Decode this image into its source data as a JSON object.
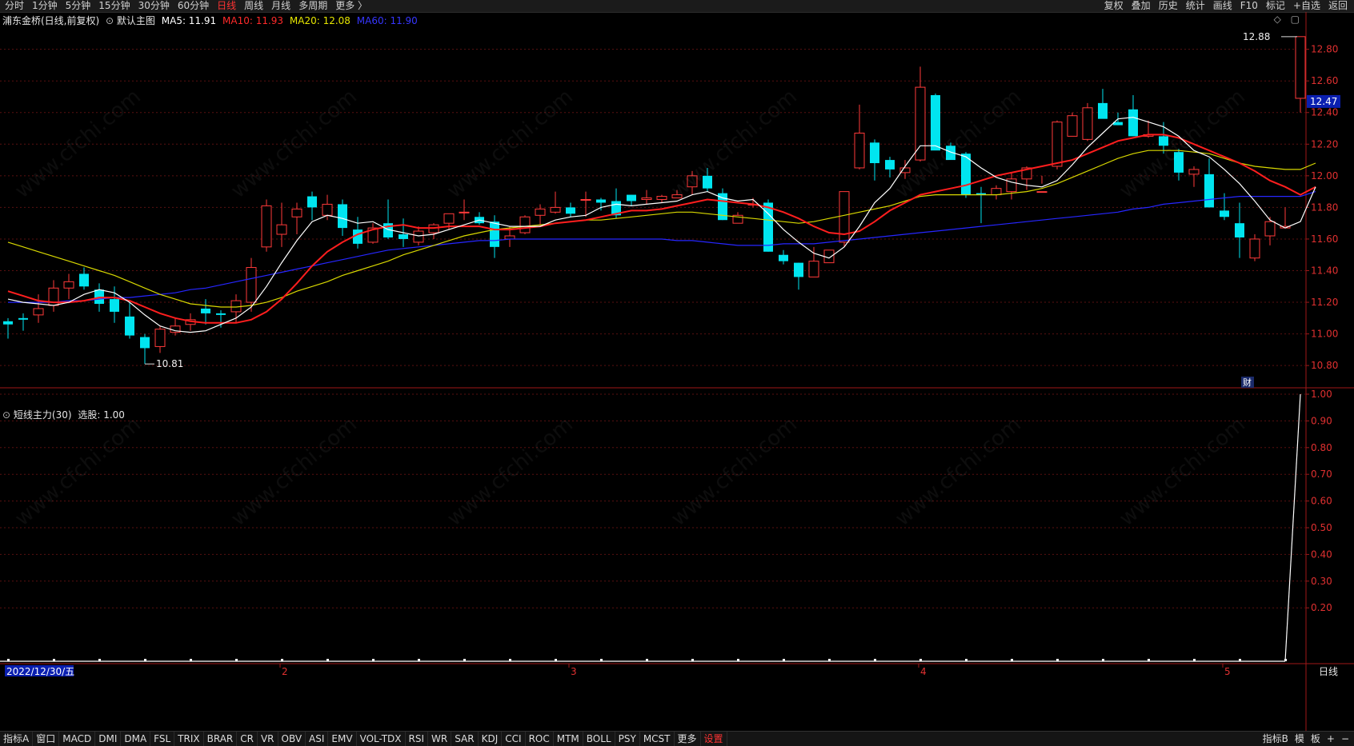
{
  "topbar": {
    "periods": [
      "分时",
      "1分钟",
      "5分钟",
      "15分钟",
      "30分钟",
      "60分钟",
      "日线",
      "周线",
      "月线",
      "多周期",
      "更多 〉"
    ],
    "active_period": "日线",
    "right_items": [
      "复权",
      "叠加",
      "历史",
      "统计",
      "画线",
      "F10",
      "标记",
      "+自选",
      "返回"
    ]
  },
  "main_panel": {
    "title": "浦东金桥(日线,前复权)",
    "template": "默认主图",
    "ma5": {
      "label": "MA5: 11.91",
      "color": "#ffffff"
    },
    "ma10": {
      "label": "MA10: 11.93",
      "color": "#ff2a2a"
    },
    "ma20": {
      "label": "MA20: 12.08",
      "color": "#e6e600"
    },
    "ma60": {
      "label": "MA60: 11.90",
      "color": "#2f2fff"
    },
    "y_ticks": [
      "12.80",
      "12.60",
      "12.40",
      "12.20",
      "12.00",
      "11.80",
      "11.60",
      "11.40",
      "11.20",
      "11.00",
      "10.80"
    ],
    "current_price": "12.47",
    "high_label": "12.88",
    "low_label": "10.81",
    "cai_label": "财"
  },
  "sub_panel": {
    "title": "短线主力(30)",
    "value_label": "选股: 1.00",
    "y_ticks": [
      "1.00",
      "0.90",
      "0.80",
      "0.70",
      "0.60",
      "0.50",
      "0.40",
      "0.30",
      "0.20"
    ]
  },
  "x_axis": {
    "date_label": "2022/12/30/五",
    "month_labels": [
      "2",
      "3",
      "4",
      "5"
    ],
    "period_label": "日线"
  },
  "bottombar": {
    "tabs": [
      "指标A",
      "窗口",
      "MACD",
      "DMI",
      "DMA",
      "FSL",
      "TRIX",
      "BRAR",
      "CR",
      "VR",
      "OBV",
      "ASI",
      "EMV",
      "VOL-TDX",
      "RSI",
      "WR",
      "SAR",
      "KDJ",
      "CCI",
      "ROC",
      "MTM",
      "BOLL",
      "PSY",
      "MCST",
      "更多",
      "设置"
    ],
    "active_tab": "设置",
    "right": [
      "指标B",
      "模",
      "板",
      "+",
      "−"
    ]
  },
  "chart_data": {
    "type": "candlestick",
    "ohlc": [
      [
        11.08,
        11.1,
        10.97,
        11.06
      ],
      [
        11.1,
        11.13,
        11.02,
        11.09
      ],
      [
        11.12,
        11.25,
        11.07,
        11.16
      ],
      [
        11.18,
        11.34,
        11.14,
        11.29
      ],
      [
        11.29,
        11.38,
        11.22,
        11.33
      ],
      [
        11.38,
        11.42,
        11.28,
        11.3
      ],
      [
        11.28,
        11.32,
        11.14,
        11.19
      ],
      [
        11.22,
        11.3,
        11.07,
        11.14
      ],
      [
        11.11,
        11.2,
        10.97,
        10.99
      ],
      [
        10.98,
        11.0,
        10.81,
        10.91
      ],
      [
        10.92,
        11.05,
        10.88,
        11.03
      ],
      [
        11.01,
        11.1,
        10.99,
        11.05
      ],
      [
        11.06,
        11.13,
        11.02,
        11.09
      ],
      [
        11.16,
        11.22,
        11.06,
        11.13
      ],
      [
        11.13,
        11.15,
        11.04,
        11.12
      ],
      [
        11.14,
        11.25,
        11.07,
        11.21
      ],
      [
        11.2,
        11.48,
        11.14,
        11.42
      ],
      [
        11.55,
        11.85,
        11.52,
        11.81
      ],
      [
        11.63,
        11.83,
        11.55,
        11.69
      ],
      [
        11.74,
        11.83,
        11.63,
        11.79
      ],
      [
        11.87,
        11.9,
        11.72,
        11.8
      ],
      [
        11.75,
        11.88,
        11.72,
        11.82
      ],
      [
        11.82,
        11.85,
        11.62,
        11.67
      ],
      [
        11.66,
        11.74,
        11.54,
        11.57
      ],
      [
        11.58,
        11.7,
        11.57,
        11.67
      ],
      [
        11.7,
        11.85,
        11.6,
        11.61
      ],
      [
        11.63,
        11.73,
        11.55,
        11.6
      ],
      [
        11.58,
        11.68,
        11.56,
        11.65
      ],
      [
        11.64,
        11.7,
        11.6,
        11.69
      ],
      [
        11.7,
        11.75,
        11.66,
        11.76
      ],
      [
        11.77,
        11.85,
        11.72,
        11.77
      ],
      [
        11.74,
        11.77,
        11.69,
        11.7
      ],
      [
        11.71,
        11.75,
        11.48,
        11.55
      ],
      [
        11.6,
        11.68,
        11.55,
        11.62
      ],
      [
        11.64,
        11.75,
        11.63,
        11.74
      ],
      [
        11.75,
        11.82,
        11.68,
        11.79
      ],
      [
        11.77,
        11.9,
        11.76,
        11.8
      ],
      [
        11.8,
        11.83,
        11.74,
        11.76
      ],
      [
        11.85,
        11.9,
        11.74,
        11.85
      ],
      [
        11.85,
        11.86,
        11.78,
        11.83
      ],
      [
        11.84,
        11.92,
        11.73,
        11.75
      ],
      [
        11.88,
        11.88,
        11.81,
        11.84
      ],
      [
        11.85,
        11.91,
        11.82,
        11.86
      ],
      [
        11.85,
        11.88,
        11.83,
        11.87
      ],
      [
        11.86,
        11.91,
        11.86,
        11.88
      ],
      [
        11.93,
        12.03,
        11.88,
        12.0
      ],
      [
        12.0,
        12.05,
        11.9,
        11.92
      ],
      [
        11.89,
        11.92,
        11.72,
        11.72
      ],
      [
        11.7,
        11.77,
        11.7,
        11.75
      ],
      [
        11.82,
        11.86,
        11.8,
        11.82
      ],
      [
        11.83,
        11.85,
        11.52,
        11.52
      ],
      [
        11.5,
        11.53,
        11.44,
        11.46
      ],
      [
        11.45,
        11.45,
        11.28,
        11.36
      ],
      [
        11.36,
        11.55,
        11.36,
        11.46
      ],
      [
        11.45,
        11.53,
        11.48,
        11.53
      ],
      [
        11.58,
        11.9,
        11.55,
        11.9
      ],
      [
        12.05,
        12.45,
        12.04,
        12.27
      ],
      [
        12.21,
        12.23,
        11.97,
        12.08
      ],
      [
        12.1,
        12.12,
        11.99,
        12.04
      ],
      [
        12.02,
        12.1,
        11.98,
        12.05
      ],
      [
        12.1,
        12.69,
        12.09,
        12.56
      ],
      [
        12.51,
        12.52,
        12.21,
        12.16
      ],
      [
        12.19,
        12.21,
        12.12,
        12.1
      ],
      [
        12.14,
        12.15,
        11.86,
        11.88
      ],
      [
        11.89,
        11.93,
        11.7,
        11.88
      ],
      [
        11.88,
        11.94,
        11.85,
        11.92
      ],
      [
        11.9,
        12.02,
        11.85,
        11.98
      ],
      [
        11.98,
        12.06,
        11.91,
        12.05
      ],
      [
        11.9,
        12.0,
        11.95,
        11.9
      ],
      [
        12.06,
        12.35,
        12.04,
        12.34
      ],
      [
        12.25,
        12.4,
        12.28,
        12.38
      ],
      [
        12.23,
        12.46,
        12.22,
        12.43
      ],
      [
        12.46,
        12.55,
        12.42,
        12.36
      ],
      [
        12.34,
        12.4,
        12.32,
        12.32
      ],
      [
        12.42,
        12.51,
        12.34,
        12.25
      ],
      [
        12.25,
        12.35,
        12.24,
        12.26
      ],
      [
        12.25,
        12.34,
        12.14,
        12.19
      ],
      [
        12.15,
        12.17,
        11.97,
        12.02
      ],
      [
        12.01,
        12.06,
        11.93,
        12.04
      ],
      [
        12.01,
        12.11,
        11.91,
        11.8
      ],
      [
        11.78,
        11.89,
        11.72,
        11.74
      ],
      [
        11.7,
        11.83,
        11.48,
        11.61
      ],
      [
        11.48,
        11.63,
        11.46,
        11.6
      ],
      [
        11.62,
        11.74,
        11.56,
        11.71
      ],
      [
        11.67,
        11.8,
        11.67,
        11.68
      ],
      [
        12.49,
        12.88,
        12.4,
        12.88
      ]
    ],
    "ma5": [
      11.22,
      11.2,
      11.19,
      11.18,
      11.2,
      11.25,
      11.28,
      11.26,
      11.2,
      11.12,
      11.05,
      11.02,
      11.01,
      11.02,
      11.06,
      11.1,
      11.17,
      11.3,
      11.45,
      11.59,
      11.71,
      11.75,
      11.73,
      11.7,
      11.71,
      11.66,
      11.64,
      11.62,
      11.63,
      11.66,
      11.69,
      11.72,
      11.7,
      11.68,
      11.68,
      11.68,
      11.72,
      11.74,
      11.75,
      11.8,
      11.82,
      11.81,
      11.82,
      11.83,
      11.84,
      11.88,
      11.9,
      11.86,
      11.84,
      11.85,
      11.76,
      11.66,
      11.58,
      11.51,
      11.48,
      11.55,
      11.68,
      11.83,
      11.92,
      12.06,
      12.19,
      12.19,
      12.15,
      12.12,
      12.05,
      11.99,
      11.96,
      11.94,
      11.93,
      11.97,
      12.07,
      12.18,
      12.27,
      12.36,
      12.37,
      12.34,
      12.31,
      12.25,
      12.16,
      12.12,
      12.04,
      11.95,
      11.84,
      11.72,
      11.67,
      11.71,
      11.93
    ],
    "ma10": [
      11.27,
      11.24,
      11.21,
      11.2,
      11.2,
      11.21,
      11.23,
      11.23,
      11.21,
      11.17,
      11.13,
      11.1,
      11.08,
      11.07,
      11.07,
      11.07,
      11.09,
      11.14,
      11.22,
      11.32,
      11.43,
      11.52,
      11.58,
      11.63,
      11.66,
      11.68,
      11.69,
      11.67,
      11.67,
      11.68,
      11.68,
      11.68,
      11.66,
      11.66,
      11.67,
      11.68,
      11.7,
      11.71,
      11.72,
      11.74,
      11.76,
      11.78,
      11.78,
      11.79,
      11.81,
      11.83,
      11.85,
      11.84,
      11.83,
      11.82,
      11.8,
      11.77,
      11.73,
      11.68,
      11.64,
      11.63,
      11.65,
      11.71,
      11.78,
      11.83,
      11.88,
      11.9,
      11.92,
      11.94,
      11.97,
      12.0,
      12.02,
      12.04,
      12.06,
      12.08,
      12.1,
      12.14,
      12.18,
      12.22,
      12.24,
      12.26,
      12.26,
      12.24,
      12.2,
      12.16,
      12.12,
      12.08,
      12.03,
      11.97,
      11.93,
      11.88,
      11.93
    ],
    "ma20": [
      11.58,
      11.55,
      11.52,
      11.49,
      11.46,
      11.43,
      11.4,
      11.37,
      11.33,
      11.29,
      11.25,
      11.22,
      11.19,
      11.18,
      11.17,
      11.17,
      11.18,
      11.2,
      11.23,
      11.27,
      11.3,
      11.33,
      11.37,
      11.4,
      11.43,
      11.46,
      11.5,
      11.53,
      11.56,
      11.59,
      11.62,
      11.64,
      11.66,
      11.67,
      11.68,
      11.69,
      11.7,
      11.71,
      11.72,
      11.72,
      11.73,
      11.74,
      11.75,
      11.76,
      11.77,
      11.77,
      11.76,
      11.75,
      11.74,
      11.73,
      11.72,
      11.71,
      11.7,
      11.71,
      11.73,
      11.75,
      11.77,
      11.79,
      11.81,
      11.84,
      11.87,
      11.88,
      11.88,
      11.88,
      11.88,
      11.88,
      11.89,
      11.9,
      11.92,
      11.95,
      11.99,
      12.03,
      12.07,
      12.11,
      12.14,
      12.16,
      12.16,
      12.16,
      12.15,
      12.14,
      12.11,
      12.08,
      12.06,
      12.05,
      12.04,
      12.04,
      12.08
    ],
    "ma60": [
      11.2,
      11.2,
      11.2,
      11.2,
      11.21,
      11.21,
      11.22,
      11.23,
      11.23,
      11.24,
      11.25,
      11.26,
      11.28,
      11.29,
      11.31,
      11.33,
      11.35,
      11.37,
      11.39,
      11.41,
      11.43,
      11.45,
      11.47,
      11.49,
      11.51,
      11.53,
      11.54,
      11.55,
      11.56,
      11.57,
      11.58,
      11.59,
      11.59,
      11.6,
      11.6,
      11.6,
      11.6,
      11.6,
      11.6,
      11.6,
      11.6,
      11.6,
      11.6,
      11.6,
      11.59,
      11.59,
      11.58,
      11.57,
      11.56,
      11.56,
      11.56,
      11.57,
      11.57,
      11.57,
      11.58,
      11.59,
      11.6,
      11.61,
      11.62,
      11.63,
      11.64,
      11.65,
      11.66,
      11.67,
      11.68,
      11.69,
      11.7,
      11.71,
      11.72,
      11.73,
      11.74,
      11.75,
      11.76,
      11.77,
      11.79,
      11.8,
      11.82,
      11.83,
      11.84,
      11.85,
      11.86,
      11.87,
      11.87,
      11.87,
      11.87,
      11.87,
      11.9
    ],
    "sub_series": {
      "name": "选股",
      "signal_last": 1.0
    },
    "ylim_main": [
      10.73,
      12.96
    ],
    "ylim_sub": [
      0.0,
      1.0
    ]
  }
}
